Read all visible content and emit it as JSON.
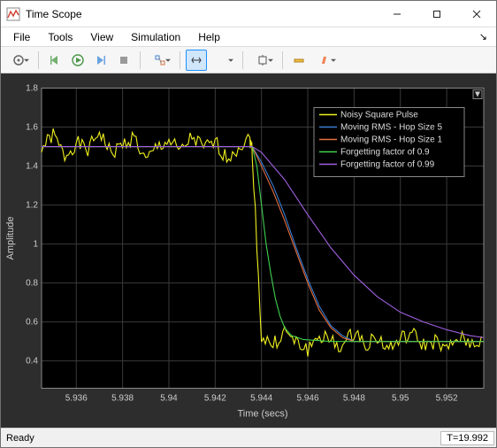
{
  "window": {
    "title": "Time Scope"
  },
  "menu": {
    "file": "File",
    "tools": "Tools",
    "view": "View",
    "simulation": "Simulation",
    "help": "Help"
  },
  "status": {
    "ready": "Ready",
    "time": "T=19.992"
  },
  "chart_data": {
    "type": "line",
    "xlabel": "Time (secs)",
    "ylabel": "Amplitude",
    "xlim": [
      5.9345,
      5.9536
    ],
    "ylim": [
      0.26,
      1.8
    ],
    "xticks": [
      5.936,
      5.938,
      5.94,
      5.942,
      5.944,
      5.946,
      5.948,
      5.95,
      5.952
    ],
    "yticks": [
      0.4,
      0.6,
      0.8,
      1,
      1.2,
      1.4,
      1.6,
      1.8
    ],
    "legend_pos": "top-right",
    "series": [
      {
        "name": "Noisy Square Pulse",
        "color": "#f0f020",
        "x": [
          5.9345,
          5.935,
          5.9355,
          5.936,
          5.9365,
          5.937,
          5.9375,
          5.938,
          5.9385,
          5.939,
          5.9395,
          5.94,
          5.9405,
          5.941,
          5.9415,
          5.942,
          5.9425,
          5.943,
          5.9435,
          5.9436,
          5.944,
          5.9445,
          5.945,
          5.9455,
          5.946,
          5.9465,
          5.947,
          5.9475,
          5.948,
          5.9485,
          5.949,
          5.9495,
          5.95,
          5.9505,
          5.951,
          5.9515,
          5.952,
          5.9525,
          5.953,
          5.9536
        ],
        "y": [
          1.49,
          1.56,
          1.45,
          1.52,
          1.48,
          1.58,
          1.46,
          1.51,
          1.55,
          1.42,
          1.5,
          1.53,
          1.47,
          1.55,
          1.49,
          1.52,
          1.44,
          1.5,
          1.54,
          1.48,
          0.52,
          0.48,
          0.55,
          0.49,
          0.46,
          0.53,
          0.5,
          0.47,
          0.55,
          0.49,
          0.52,
          0.46,
          0.51,
          0.54,
          0.48,
          0.5,
          0.45,
          0.52,
          0.49,
          0.51
        ]
      },
      {
        "name": "Moving RMS - Hop Size 5",
        "color": "#3a7fd5",
        "x": [
          5.9345,
          5.9436,
          5.944,
          5.9445,
          5.945,
          5.9455,
          5.946,
          5.9465,
          5.947,
          5.9475,
          5.948,
          5.9536
        ],
        "y": [
          1.5,
          1.5,
          1.42,
          1.3,
          1.15,
          0.98,
          0.82,
          0.68,
          0.58,
          0.53,
          0.5,
          0.5
        ]
      },
      {
        "name": "Moving RMS - Hop Size 1",
        "color": "#e87040",
        "x": [
          5.9345,
          5.9436,
          5.944,
          5.9445,
          5.945,
          5.9455,
          5.946,
          5.9465,
          5.947,
          5.9475,
          5.948,
          5.9536
        ],
        "y": [
          1.5,
          1.5,
          1.4,
          1.27,
          1.12,
          0.96,
          0.8,
          0.66,
          0.57,
          0.52,
          0.5,
          0.5
        ]
      },
      {
        "name": "Forgetting factor of 0.9",
        "color": "#40d050",
        "x": [
          5.9345,
          5.9436,
          5.9438,
          5.944,
          5.9442,
          5.9444,
          5.9446,
          5.9448,
          5.945,
          5.9453,
          5.9458,
          5.947,
          5.949,
          5.9536
        ],
        "y": [
          1.5,
          1.5,
          1.4,
          1.2,
          1.0,
          0.85,
          0.72,
          0.63,
          0.57,
          0.53,
          0.51,
          0.5,
          0.5,
          0.5
        ]
      },
      {
        "name": "Forgetting factor of 0.99",
        "color": "#a060e0",
        "x": [
          5.9345,
          5.9436,
          5.944,
          5.945,
          5.946,
          5.947,
          5.948,
          5.949,
          5.95,
          5.951,
          5.952,
          5.953,
          5.9536
        ],
        "y": [
          1.5,
          1.5,
          1.47,
          1.33,
          1.15,
          0.98,
          0.84,
          0.73,
          0.65,
          0.6,
          0.56,
          0.53,
          0.52
        ]
      }
    ]
  }
}
